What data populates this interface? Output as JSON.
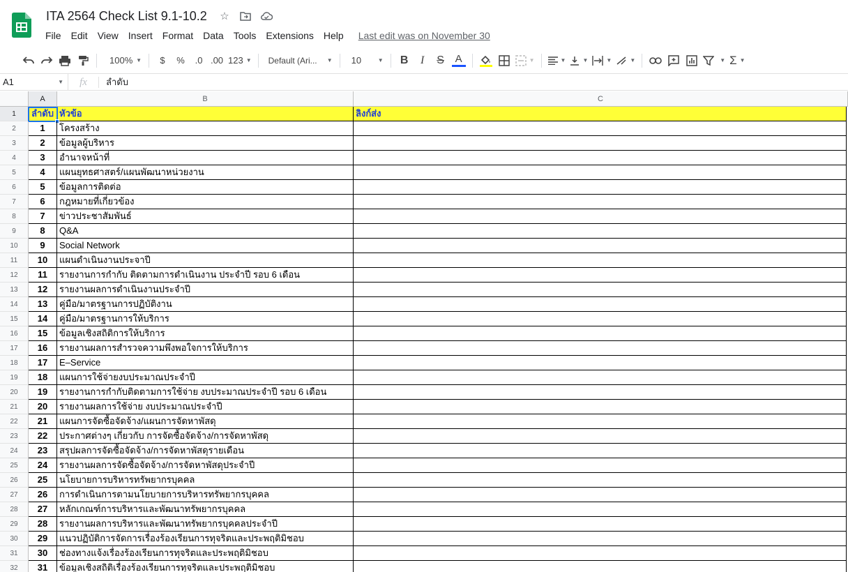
{
  "doc": {
    "title": "ITA 2564 Check List 9.1-10.2",
    "last_edit": "Last edit was on November 30"
  },
  "menu": [
    "File",
    "Edit",
    "View",
    "Insert",
    "Format",
    "Data",
    "Tools",
    "Extensions",
    "Help"
  ],
  "toolbar": {
    "zoom": "100%",
    "currency": "$",
    "percent": "%",
    "decrease_decimal": ".0",
    "increase_decimal": ".00",
    "more_formats": "123",
    "font": "Default (Ari...",
    "font_size": "10",
    "bold": "B",
    "italic": "I",
    "strike": "S",
    "text_color_letter": "A",
    "text_color": "#1a53ff",
    "fill_color": "#ffff00"
  },
  "formula_bar": {
    "cell_ref": "A1",
    "fx": "fx",
    "content": "ลำดับ"
  },
  "columns": [
    "A",
    "B",
    "C"
  ],
  "header_fill": "#ffff37",
  "header_text_color": "#1f3fd6",
  "header_row": {
    "num": "1",
    "a": "ลำดับ",
    "b": "หัวข้อ",
    "c": "ลิงก์ส่ง"
  },
  "rows": [
    {
      "num": "2",
      "a": "1",
      "b": "โครงสร้าง"
    },
    {
      "num": "3",
      "a": "2",
      "b": "ข้อมูลผู้บริหาร"
    },
    {
      "num": "4",
      "a": "3",
      "b": "อำนาจหน้าที่"
    },
    {
      "num": "5",
      "a": "4",
      "b": "แผนยุทธศาสตร์/แผนพัฒนาหน่วยงาน"
    },
    {
      "num": "6",
      "a": "5",
      "b": "ข้อมูลการติดต่อ"
    },
    {
      "num": "7",
      "a": "6",
      "b": "กฎหมายที่เกี่ยวข้อง"
    },
    {
      "num": "8",
      "a": "7",
      "b": "ข่าวประชาสัมพันธ์"
    },
    {
      "num": "9",
      "a": "8",
      "b": "Q&A"
    },
    {
      "num": "10",
      "a": "9",
      "b": "Social Network"
    },
    {
      "num": "11",
      "a": "10",
      "b": "แผนดำเนินงานประจาปี"
    },
    {
      "num": "12",
      "a": "11",
      "b": "รายงานการกำกับ ติดตามการดำเนินงาน ประจำปี รอบ 6 เดือน"
    },
    {
      "num": "13",
      "a": "12",
      "b": "รายงานผลการดำเนินงานประจำปี"
    },
    {
      "num": "14",
      "a": "13",
      "b": "คู่มือ/มาตรฐานการปฏิบัติงาน"
    },
    {
      "num": "15",
      "a": "14",
      "b": "คู่มือ/มาตรฐานการให้บริการ"
    },
    {
      "num": "16",
      "a": "15",
      "b": "ข้อมูลเชิงสถิติการให้บริการ"
    },
    {
      "num": "17",
      "a": "16",
      "b": "รายงานผลการสำรวจความพึงพอใจการให้บริการ"
    },
    {
      "num": "18",
      "a": "17",
      "b": "E–Service"
    },
    {
      "num": "19",
      "a": "18",
      "b": "แผนการใช้จ่ายงบประมาณประจำปี"
    },
    {
      "num": "20",
      "a": "19",
      "b": "รายงานการกำกับติดตามการใช้จ่าย งบประมาณประจำปี รอบ 6 เดือน"
    },
    {
      "num": "21",
      "a": "20",
      "b": "รายงานผลการใช้จ่าย งบประมาณประจำปี"
    },
    {
      "num": "22",
      "a": "21",
      "b": "แผนการจัดซื้อจัดจ้าง/แผนการจัดหาพัสดุ"
    },
    {
      "num": "23",
      "a": "22",
      "b": "ประกาศต่างๆ เกี่ยวกับ การจัดซื้อจัดจ้าง/การจัดหาพัสดุ"
    },
    {
      "num": "24",
      "a": "23",
      "b": "สรุปผลการจัดซื้อจัดจ้าง/การจัดหาพัสดุรายเดือน"
    },
    {
      "num": "25",
      "a": "24",
      "b": "รายงานผลการจัดซื้อจัดจ้าง/การจัดหาพัสดุประจำปี"
    },
    {
      "num": "26",
      "a": "25",
      "b": "นโยบายการบริหารทรัพยากรบุคคล"
    },
    {
      "num": "27",
      "a": "26",
      "b": "การดำเนินการตามนโยบายการบริหารทรัพยากรบุคคล"
    },
    {
      "num": "28",
      "a": "27",
      "b": "หลักเกณฑ์การบริหารและพัฒนาทรัพยากรบุคคล"
    },
    {
      "num": "29",
      "a": "28",
      "b": "รายงานผลการบริหารและพัฒนาทรัพยากรบุคคลประจำปี"
    },
    {
      "num": "30",
      "a": "29",
      "b": "แนวปฏิบัติการจัดการเรื่องร้องเรียนการทุจริตและประพฤติมิชอบ"
    },
    {
      "num": "31",
      "a": "30",
      "b": "ช่องทางแจ้งเรื่องร้องเรียนการทุจริตและประพฤติมิชอบ"
    },
    {
      "num": "32",
      "a": "31",
      "b": "ข้อมูลเชิงสถิติเรื่องร้องเรียนการทุจริตและประพฤติมิชอบ"
    }
  ]
}
